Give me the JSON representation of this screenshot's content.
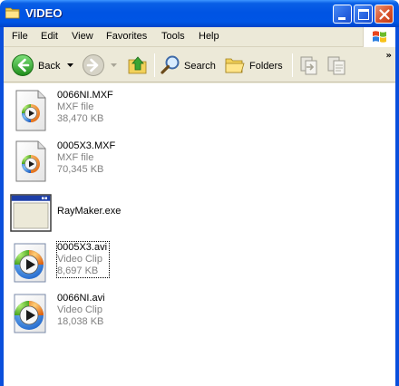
{
  "window": {
    "title": "VIDEO"
  },
  "menu": {
    "items": [
      "File",
      "Edit",
      "View",
      "Favorites",
      "Tools",
      "Help"
    ]
  },
  "toolbar": {
    "back_label": "Back",
    "search_label": "Search",
    "folders_label": "Folders"
  },
  "files": [
    {
      "name": "0066NI.MXF",
      "type": "MXF file",
      "size": "38,470 KB",
      "icon": "mxf-file-icon"
    },
    {
      "name": "0005X3.MXF",
      "type": "MXF file",
      "size": "70,345 KB",
      "icon": "mxf-file-icon"
    },
    {
      "name": "RayMaker.exe",
      "icon": "application-icon"
    },
    {
      "name": "0005X3.avi",
      "type": "Video Clip",
      "size": "8,697 KB",
      "icon": "video-clip-icon"
    },
    {
      "name": "0066NI.avi",
      "type": "Video Clip",
      "size": "18,038 KB",
      "icon": "video-clip-icon"
    }
  ]
}
